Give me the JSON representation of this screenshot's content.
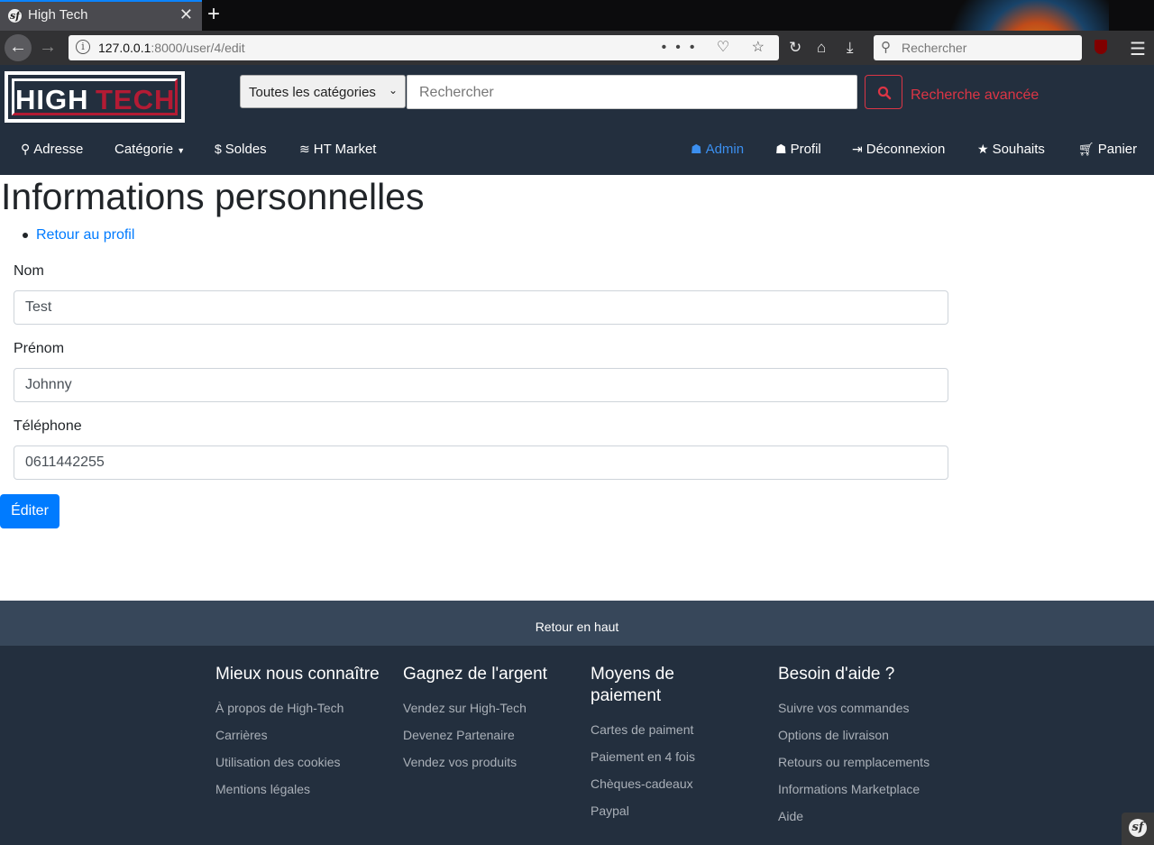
{
  "browser": {
    "tab_title": "High Tech",
    "url_host": "127.0.0.1",
    "url_rest": ":8000/user/4/edit",
    "search_placeholder": "Rechercher",
    "page_actions": "••• ♡ ☆"
  },
  "header": {
    "logo_high": "HIGH",
    "logo_tech": "TECH",
    "category_select": "Toutes les catégories",
    "search_placeholder": "Rechercher",
    "advanced_search": "Recherche avancée",
    "nav_left": [
      {
        "label": "Adresse",
        "icon": "map-marker-icon"
      },
      {
        "label": "Catégorie",
        "icon": "caret-down-icon"
      },
      {
        "label": "Soldes",
        "icon": "dollar-icon"
      },
      {
        "label": "HT Market",
        "icon": "coins-icon"
      }
    ],
    "nav_right": [
      {
        "label": "Admin",
        "icon": "users-icon"
      },
      {
        "label": "Profil",
        "icon": "user-icon"
      },
      {
        "label": "Déconnexion",
        "icon": "sign-out-icon"
      },
      {
        "label": "Souhaits",
        "icon": "star-icon"
      },
      {
        "label": "Panier",
        "icon": "cart-icon"
      }
    ],
    "active_color": "#3b8fef"
  },
  "main": {
    "title": "Informations personnelles",
    "back_link": "Retour au profil",
    "fields": [
      {
        "label": "Nom",
        "value": "Test"
      },
      {
        "label": "Prénom",
        "value": "Johnny"
      },
      {
        "label": "Téléphone",
        "value": "0611442255"
      }
    ],
    "submit": "Éditer"
  },
  "footer": {
    "back_to_top": "Retour en haut",
    "columns": [
      {
        "title": "Mieux nous connaître",
        "links": [
          "À propos de High-Tech",
          "Carrières",
          "Utilisation des cookies",
          "Mentions légales"
        ]
      },
      {
        "title": "Gagnez de l'argent",
        "links": [
          "Vendez sur High-Tech",
          "Devenez Partenaire",
          "Vendez vos produits"
        ]
      },
      {
        "title": "Moyens de paiement",
        "links": [
          "Cartes de paiment",
          "Paiement en 4 fois",
          "Chèques-cadeaux",
          "Paypal"
        ]
      },
      {
        "title": "Besoin d'aide ?",
        "links": [
          "Suivre vos commandes",
          "Options de livraison",
          "Retours ou remplacements",
          "Informations Marketplace",
          "Aide"
        ]
      }
    ]
  },
  "colors": {
    "header_bg": "#232f3e",
    "brand_red": "#b31b34",
    "primary": "#007bff",
    "danger": "#dc3545"
  }
}
